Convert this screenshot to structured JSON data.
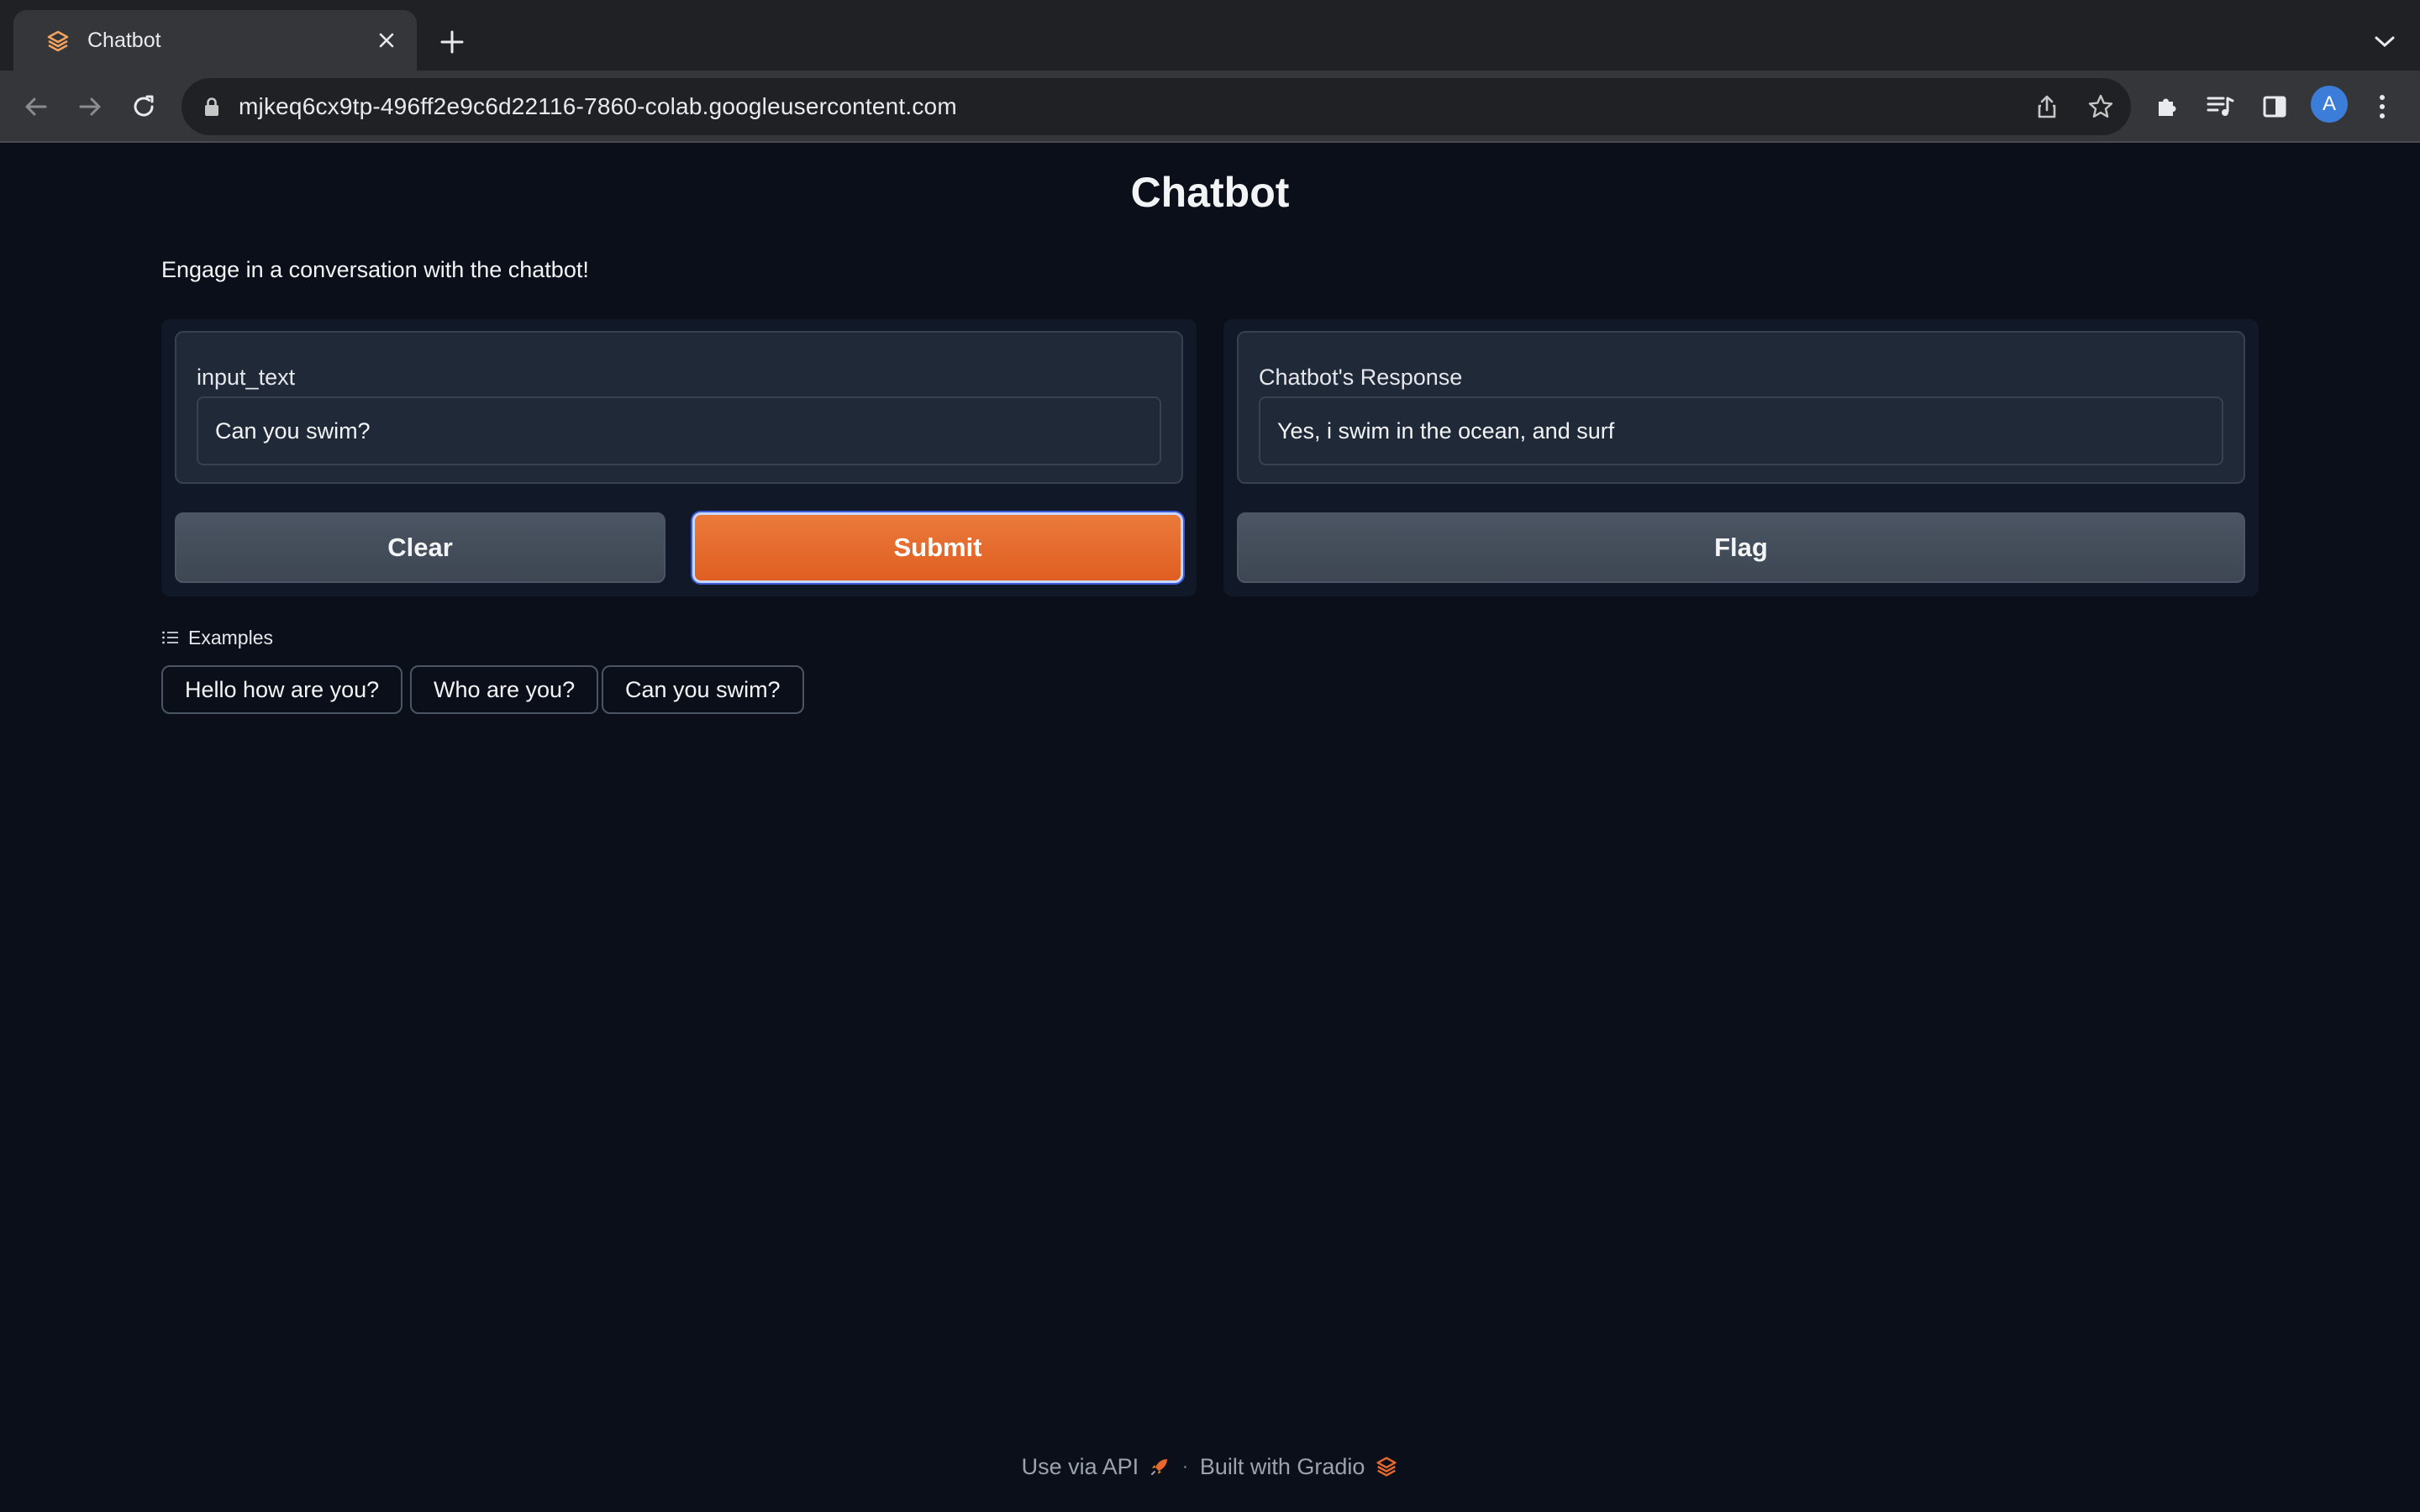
{
  "browser": {
    "tab": {
      "title": "Chatbot",
      "favicon": "gradio-logo-icon"
    },
    "url": "mjkeq6cx9tp-496ff2e9c6d22116-7860-colab.googleusercontent.com",
    "profile_initial": "A"
  },
  "page": {
    "title": "Chatbot",
    "description": "Engage in a conversation with the chatbot!"
  },
  "input_panel": {
    "label": "input_text",
    "value": "Can you swim?",
    "clear_label": "Clear",
    "submit_label": "Submit"
  },
  "output_panel": {
    "label": "Chatbot's Response",
    "value": "Yes, i swim in the ocean, and surf",
    "flag_label": "Flag"
  },
  "examples": {
    "label": "Examples",
    "items": [
      "Hello how are you?",
      "Who are you?",
      "Can you swim?"
    ]
  },
  "footer": {
    "api_label": "Use via API",
    "separator": "·",
    "built_with": "Built with Gradio"
  },
  "colors": {
    "background": "#0b0f19",
    "primary": "#e8692b",
    "panel": "#111827",
    "block": "#1f2937"
  }
}
